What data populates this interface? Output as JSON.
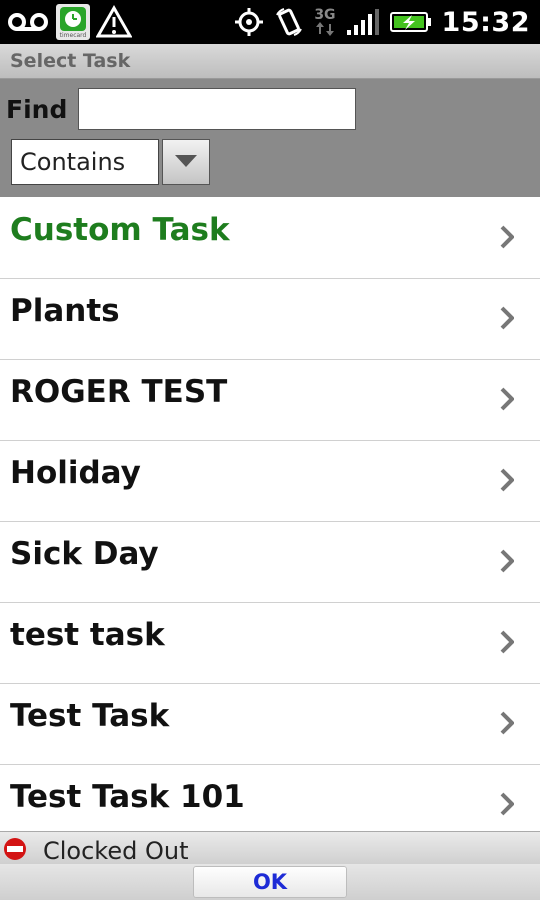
{
  "status_bar": {
    "time": "15:32",
    "network": "3G",
    "icons": [
      "voicemail-icon",
      "app-notification-icon",
      "warning-icon",
      "gps-icon",
      "rotate-lock-icon",
      "signal-icon",
      "battery-charging-icon"
    ],
    "app_icon_caption": "timecard"
  },
  "title": "Select Task",
  "find": {
    "label": "Find",
    "value": "",
    "placeholder": "",
    "match_mode": "Contains"
  },
  "tasks": [
    {
      "label": "Custom Task",
      "accent": true
    },
    {
      "label": "Plants"
    },
    {
      "label": "ROGER TEST"
    },
    {
      "label": "Holiday"
    },
    {
      "label": "Sick Day"
    },
    {
      "label": "test task"
    },
    {
      "label": "Test Task"
    },
    {
      "label": "Test Task 101"
    }
  ],
  "status": {
    "text": "Clocked Out"
  },
  "actions": {
    "ok_label": "OK"
  },
  "colors": {
    "accent": "#1e7d1e",
    "ok_text": "#1d2bd6",
    "stop_icon": "#d31414"
  }
}
